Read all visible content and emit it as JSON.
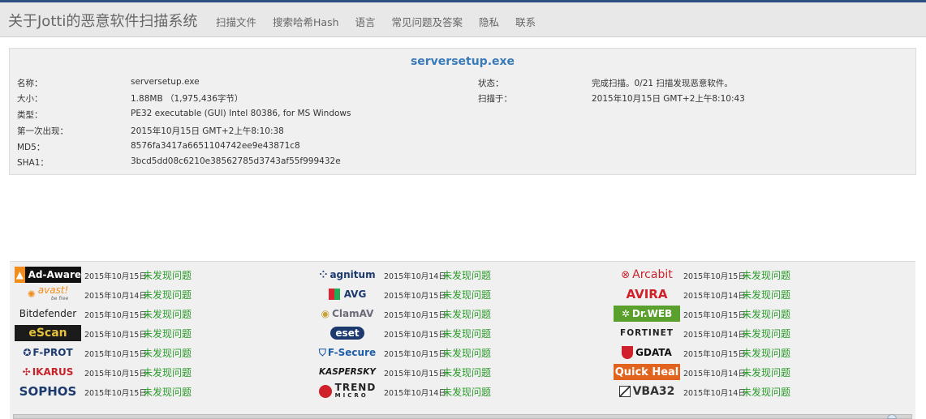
{
  "header": {
    "title": "关于Jotti的恶意软件扫描系统",
    "nav": [
      "扫描文件",
      "搜索哈希Hash",
      "语言",
      "常见问题及答案",
      "隐私",
      "联系"
    ]
  },
  "file": {
    "name_heading": "serversetup.exe",
    "fields": [
      {
        "label": "名称：",
        "value": "serversetup.exe"
      },
      {
        "label": "大小：",
        "value": "1.88MB （1,975,436字节）"
      },
      {
        "label": "类型：",
        "value": "PE32 executable (GUI) Intel 80386, for MS Windows"
      },
      {
        "label": "第一次出现：",
        "value": "2015年10月15日 GMT+2上午8:10:38"
      },
      {
        "label": "MD5：",
        "value": "8576fa3417a6651104742ee9e43871c8"
      },
      {
        "label": "SHA1：",
        "value": "3bcd5dd08c6210e38562785d3743af55f999432e"
      }
    ],
    "status_label": "状态：",
    "status_value": "完成扫描。0/21 扫描发现恶意软件。",
    "scanned_label": "扫描于：",
    "scanned_value": "2015年10月15日 GMT+2上午8:10:43"
  },
  "engines": [
    {
      "name": "Ad-Aware",
      "date": "2015年10月15日",
      "result": "未发现问题"
    },
    {
      "name": "agnitum",
      "date": "2015年10月14日",
      "result": "未发现问题"
    },
    {
      "name": "Arcabit",
      "date": "2015年10月15日",
      "result": "未发现问题"
    },
    {
      "name": "avast!",
      "tagline": "be free",
      "date": "2015年10月14日",
      "result": "未发现问题"
    },
    {
      "name": "AVG",
      "date": "2015年10月15日",
      "result": "未发现问题"
    },
    {
      "name": "AVIRA",
      "date": "2015年10月14日",
      "result": "未发现问题"
    },
    {
      "name": "Bitdefender",
      "date": "2015年10月15日",
      "result": "未发现问题"
    },
    {
      "name": "ClamAV",
      "date": "2015年10月15日",
      "result": "未发现问题"
    },
    {
      "name": "Dr.WEB",
      "date": "2015年10月15日",
      "result": "未发现问题"
    },
    {
      "name": "eScan",
      "date": "2015年10月15日",
      "result": "未发现问题"
    },
    {
      "name": "eset",
      "date": "2015年10月15日",
      "result": "未发现问题"
    },
    {
      "name": "FORTINET",
      "date": "2015年10月14日",
      "result": "未发现问题"
    },
    {
      "name": "F-PROT",
      "date": "2015年10月15日",
      "result": "未发现问题"
    },
    {
      "name": "F-Secure",
      "date": "2015年10月15日",
      "result": "未发现问题"
    },
    {
      "name": "GDATA",
      "date": "2015年10月15日",
      "result": "未发现问题"
    },
    {
      "name": "IKARUS",
      "date": "2015年10月15日",
      "result": "未发现问题"
    },
    {
      "name": "KASPERSKY",
      "date": "2015年10月15日",
      "result": "未发现问题"
    },
    {
      "name": "Quick Heal",
      "date": "2015年10月14日",
      "result": "未发现问题"
    },
    {
      "name": "SOPHOS",
      "date": "2015年10月15日",
      "result": "未发现问题"
    },
    {
      "name": "TREND",
      "tagline": "MICRO",
      "date": "2015年10月14日",
      "result": "未发现问题"
    },
    {
      "name": "VBA32",
      "date": "2015年10月14日",
      "result": "未发现问题"
    }
  ],
  "colors": {
    "accent": "#2c4f82",
    "heading": "#3a7ab8",
    "clean": "#2a9a2a"
  }
}
